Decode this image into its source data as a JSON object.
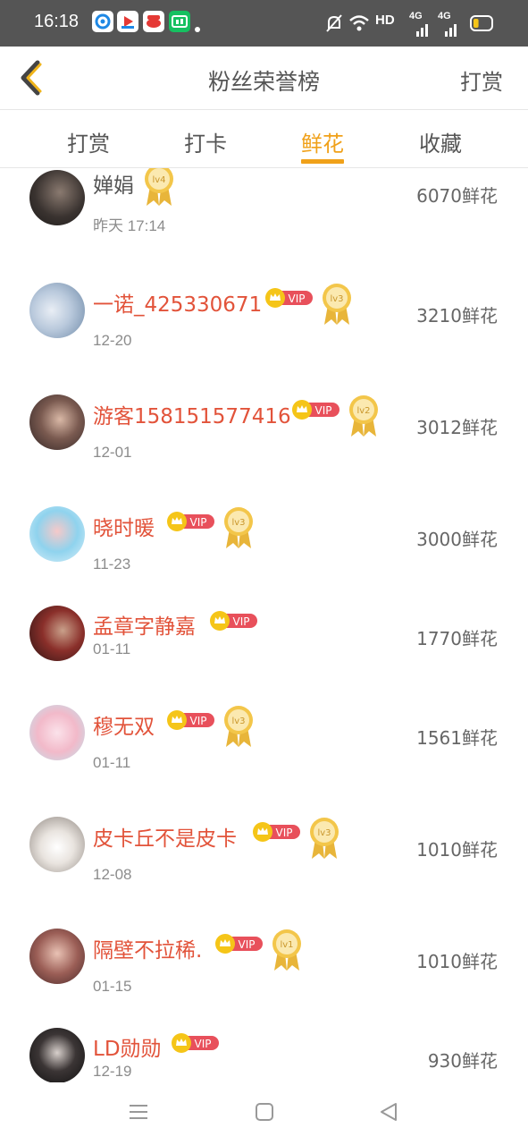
{
  "status_bar": {
    "time": "16:18",
    "app_icons": [
      "app-circle-icon",
      "video-app-icon",
      "weibo-icon",
      "iqiyi-icon"
    ],
    "network_label": "HD",
    "signal_label_1": "4G",
    "signal_label_2": "4G",
    "battery_level": 0.2,
    "colors": {
      "background": "#555555",
      "battery": "#f5c518"
    }
  },
  "header": {
    "title": "粉丝荣誉榜",
    "action_label": "打赏",
    "back_icon": "chevron-left-icon",
    "accent_color": "#f0a11a"
  },
  "tabs": [
    {
      "label": "打赏",
      "active": false
    },
    {
      "label": "打卡",
      "active": false
    },
    {
      "label": "鲜花",
      "active": true
    },
    {
      "label": "收藏",
      "active": false
    }
  ],
  "list": {
    "rows": [
      {
        "name": "婵娟",
        "date": "昨天 17:14",
        "amount": "6070鲜花",
        "vip": false,
        "vip_label": "",
        "level": "lv4"
      },
      {
        "name": "一诺_425330671",
        "date": "12-20",
        "amount": "3210鲜花",
        "vip": true,
        "vip_label": "VIP",
        "level": "lv3"
      },
      {
        "name": "游客158151577416",
        "date": "12-01",
        "amount": "3012鲜花",
        "vip": true,
        "vip_label": "VIP",
        "level": "lv2"
      },
      {
        "name": "晓时暖",
        "date": "11-23",
        "amount": "3000鲜花",
        "vip": true,
        "vip_label": "VIP",
        "level": "lv3"
      },
      {
        "name": "孟章字静嘉",
        "date": "01-11",
        "amount": "1770鲜花",
        "vip": true,
        "vip_label": "VIP",
        "level": ""
      },
      {
        "name": "穆无双",
        "date": "01-11",
        "amount": "1561鲜花",
        "vip": true,
        "vip_label": "VIP",
        "level": "lv3"
      },
      {
        "name": "皮卡丘不是皮卡",
        "date": "12-08",
        "amount": "1010鲜花",
        "vip": true,
        "vip_label": "VIP",
        "level": "lv3"
      },
      {
        "name": "隔壁不拉稀.",
        "date": "01-15",
        "amount": "1010鲜花",
        "vip": true,
        "vip_label": "VIP",
        "level": "lv1"
      },
      {
        "name": "LD勋勋",
        "date": "12-19",
        "amount": "930鲜花",
        "vip": true,
        "vip_label": "VIP",
        "level": ""
      }
    ],
    "colors": {
      "vip_name": "#e2533a",
      "plain_name": "#555555",
      "vip_badge": "#e8505b",
      "crown": "#f5c518",
      "medal": "#e8b53a"
    }
  },
  "nav_bar": {
    "icons": [
      "menu-icon",
      "home-square-icon",
      "back-triangle-icon"
    ]
  }
}
